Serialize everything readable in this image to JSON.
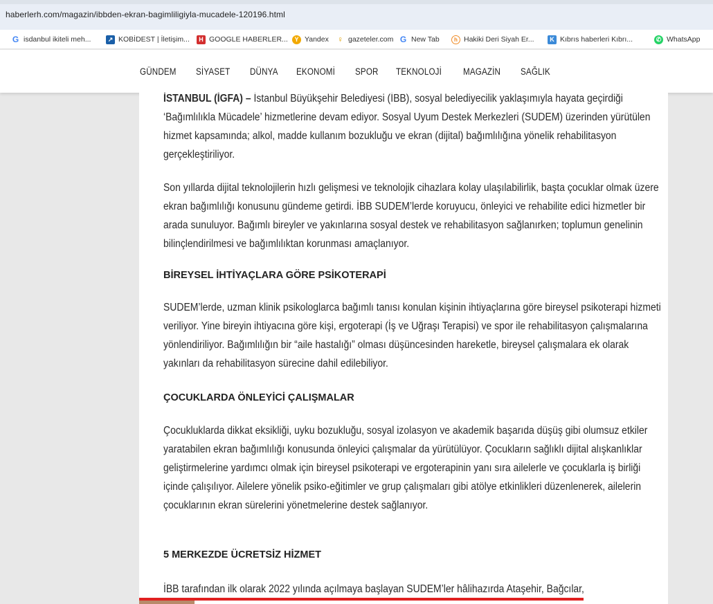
{
  "browser": {
    "url": "haberlerh.com/magazin/ibbden-ekran-bagimliligiyla-mucadele-120196.html"
  },
  "bookmarks": [
    {
      "label": "isdanbul ikiteli meh...",
      "icon": "google-g-icon"
    },
    {
      "label": "KOBİDEST | İletişim...",
      "icon": "kobidest-icon"
    },
    {
      "label": "GOOGLE HABERLER...",
      "icon": "haberler-h-icon"
    },
    {
      "label": "Yandex",
      "icon": "yandex-icon"
    },
    {
      "label": "gazeteler.com",
      "icon": "gazeteler-icon"
    },
    {
      "label": "New Tab",
      "icon": "google-g-icon"
    },
    {
      "label": "Hakiki Deri Siyah Er...",
      "icon": "hakiki-icon"
    },
    {
      "label": "Kıbrıs haberleri Kıbrı...",
      "icon": "kibris-icon"
    },
    {
      "label": "WhatsApp",
      "icon": "whatsapp-icon"
    }
  ],
  "nav": [
    "GÜNDEM",
    "SİYASET",
    "DÜNYA",
    "EKONOMİ",
    "SPOR",
    "TEKNOLOJİ",
    "MAGAZİN",
    "SAĞLIK"
  ],
  "article": {
    "lead_bold": "İSTANBUL (İGFA) –",
    "lead_text": " İstanbul Büyükşehir Belediyesi (İBB), sosyal belediyecilik yaklaşımıyla hayata geçirdiği ‘Bağımlılıkla Mücadele’ hizmetlerine devam ediyor. Sosyal Uyum Destek Merkezleri (SUDEM) üzerinden yürütülen hizmet kapsamında; alkol, madde kullanım bozukluğu ve ekran (dijital) bağımlılığına yönelik rehabilitasyon gerçekleştiriliyor.",
    "p2": "Son yıllarda dijital teknolojilerin hızlı gelişmesi ve teknolojik cihazlara kolay ulaşılabilirlik, başta çocuklar olmak üzere ekran bağımlılığı konusunu gündeme getirdi. İBB SUDEM’lerde koruyucu, önleyici ve rehabilite edici hizmetler bir arada sunuluyor. Bağımlı bireyler ve yakınlarına sosyal destek ve rehabilitasyon sağlanırken; toplumun genelinin bilinçlendirilmesi ve bağımlılıktan korunması amaçlanıyor.",
    "h1": "BİREYSEL İHTİYAÇLARA GÖRE PSİKOTERAPİ",
    "p3": "SUDEM’lerde, uzman klinik psikologlarca bağımlı tanısı konulan kişinin ihtiyaçlarına göre bireysel psikoterapi hizmeti veriliyor. Yine bireyin ihtiyacına göre kişi, ergoterapi (İş ve Uğraşı Terapisi) ve spor ile rehabilitasyon çalışmalarına yönlendiriliyor. Bağımlılığın bir “aile hastalığı” olması düşüncesinden hareketle, bireysel çalışmalara ek olarak yakınları da rehabilitasyon sürecine dahil edilebiliyor.",
    "h2": "ÇOCUKLARDA ÖNLEYİCİ ÇALIŞMALAR",
    "p4": "Çocukluklarda dikkat eksikliği, uyku bozukluğu, sosyal izolasyon ve akademik başarıda düşüş gibi olumsuz etkiler yaratabilen ekran bağımlılığı konusunda önleyici çalışmalar da yürütülüyor. Çocukların sağlıklı dijital alışkanlıklar geliştirmelerine yardımcı olmak için bireysel psikoterapi ve ergoterapinin yanı sıra ailelerle ve çocuklarla iş birliği içinde çalışılıyor. Ailelere yönelik psiko-eğitimler ve grup çalışmaları gibi atölye etkinlikleri düzenlenerek, ailelerin çocuklarının ekran sürelerini yönetmelerine destek sağlanıyor.",
    "h3": "5 MERKEZDE ÜCRETSİZ HİZMET",
    "p5": "İBB tarafından ilk olarak 2022 yılında açılmaya başlayan SUDEM’ler hâlihazırda Ataşehir, Bağcılar,"
  }
}
